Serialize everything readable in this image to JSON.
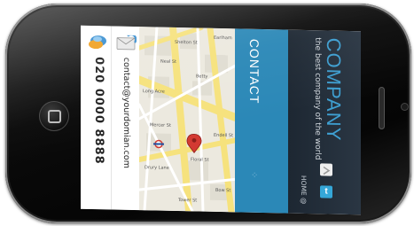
{
  "header": {
    "company_name": "COMPANY",
    "tagline": "the best company of the world",
    "nav_home": "HOME @",
    "social_button": "t"
  },
  "contact": {
    "title": "CONTACT",
    "phone_number": "020 0000 8888",
    "email": "contact@yourdomian.com"
  },
  "map": {
    "streets": [
      "Long Acre",
      "Endell St",
      "Shelton St",
      "Floral St",
      "Bow St",
      "Drury Lane",
      "Earlham",
      "Betty",
      "Mercer St",
      "Tower St",
      "Neal St"
    ]
  },
  "colors": {
    "accent_blue": "#2b88b7",
    "header_dark": "#1d2732",
    "company_blue": "#3e9fd1",
    "map_road_yellow": "#f6e27d",
    "map_marker_red": "#d33a32"
  }
}
